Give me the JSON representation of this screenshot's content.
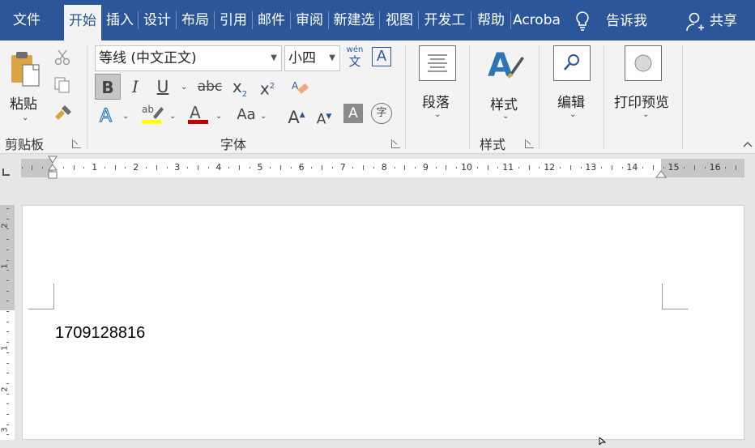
{
  "tabs": [
    {
      "label": "文件",
      "active": false
    },
    {
      "label": "开始",
      "active": true
    },
    {
      "label": "插入",
      "active": false
    },
    {
      "label": "设计",
      "active": false
    },
    {
      "label": "布局",
      "active": false
    },
    {
      "label": "引用",
      "active": false
    },
    {
      "label": "邮件",
      "active": false
    },
    {
      "label": "审阅",
      "active": false
    },
    {
      "label": "新建选",
      "active": false
    },
    {
      "label": "视图",
      "active": false
    },
    {
      "label": "开发工",
      "active": false
    },
    {
      "label": "帮助",
      "active": false
    },
    {
      "label": "Acroba",
      "active": false
    }
  ],
  "tell_me": "告诉我",
  "share": "共享",
  "clipboard": {
    "paste_label": "粘贴",
    "group_label": "剪贴板"
  },
  "font": {
    "name": "等线 (中文正文)",
    "size": "小四",
    "group_label": "字体",
    "bold": "B",
    "italic": "I",
    "underline": "U",
    "strike": "abc",
    "subscript": "x",
    "sub_mark": "2",
    "superscript": "x",
    "sup_mark": "2",
    "change_case": "Aa",
    "grow": "A",
    "shrink": "A",
    "shade": "A",
    "enclose": "字",
    "pinyin_top": "wén",
    "pinyin_bottom": "文",
    "border_char": "A"
  },
  "paragraph": {
    "label": "段落"
  },
  "styles": {
    "label": "样式",
    "group_label": "样式"
  },
  "editing": {
    "label": "编辑"
  },
  "print_preview": {
    "label": "打印预览"
  },
  "ruler": {
    "h_numbers": [
      "1",
      "2",
      "3",
      "4",
      "5",
      "6",
      "7",
      "8",
      "9",
      "10",
      "11",
      "12",
      "13",
      "14",
      "15",
      "16"
    ],
    "v_numbers": [
      "2",
      "1",
      "1",
      "2",
      "3"
    ]
  },
  "document": {
    "text": "1709128816"
  },
  "colors": {
    "brand": "#2b579a",
    "highlight": "#ffff00",
    "font_color": "#c00000"
  }
}
